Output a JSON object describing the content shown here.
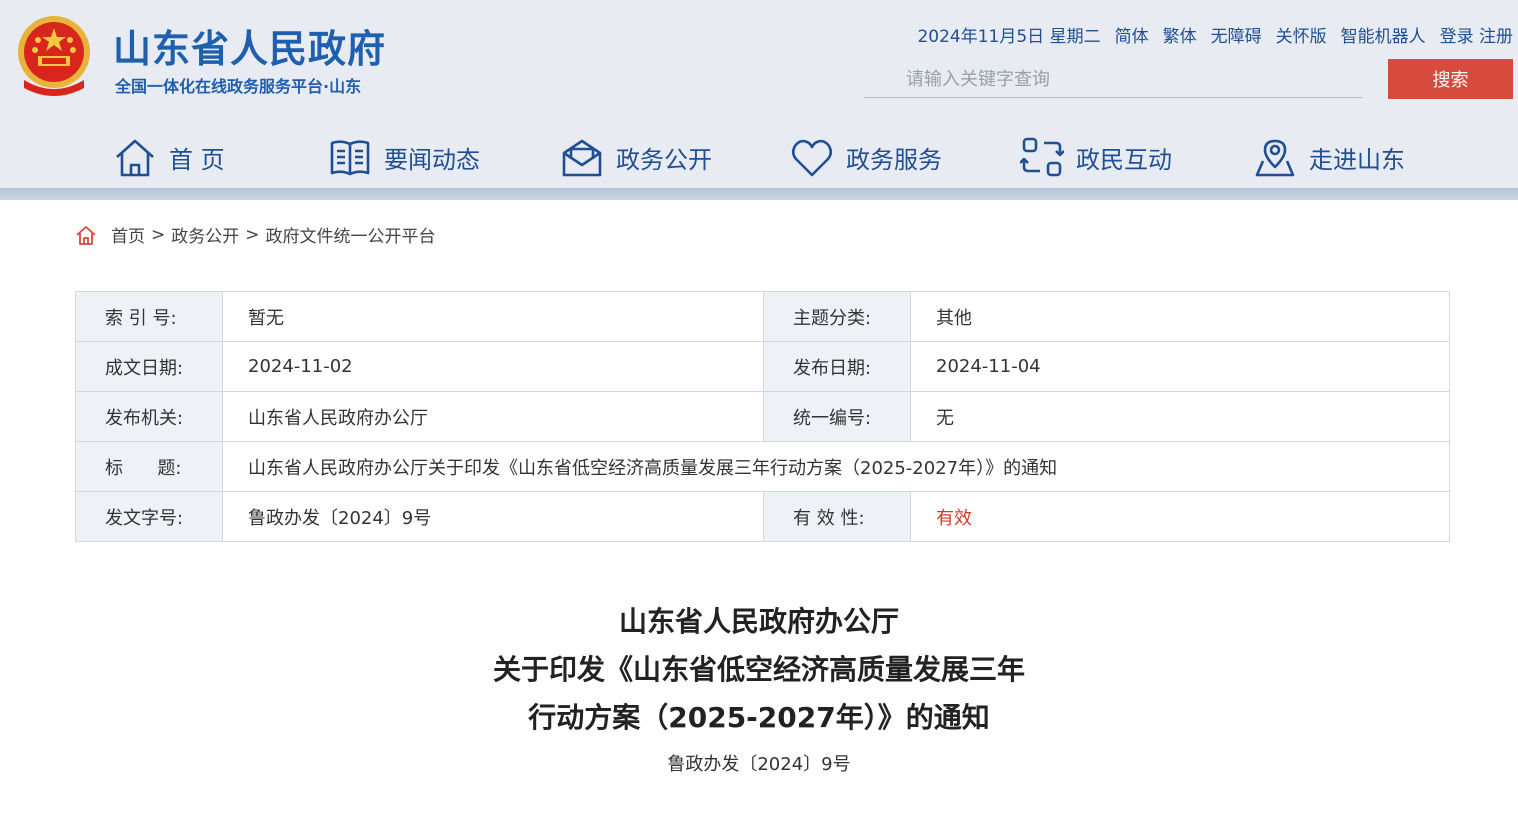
{
  "site": {
    "title": "山东省人民政府",
    "subtitle": "全国一体化在线政务服务平台·山东",
    "emblem_icon": "national-emblem-icon",
    "brand_color": "#1f5fb0"
  },
  "toplinks": {
    "date": "2024年11月5日 星期二",
    "simplified": "简体",
    "traditional": "繁体",
    "accessibility": "无障碍",
    "care_mode": "关怀版",
    "robot": "智能机器人",
    "login_register": "登录 注册"
  },
  "search": {
    "placeholder": "请输入关键字查询",
    "button_label": "搜索",
    "button_color": "#d64b3c"
  },
  "nav": {
    "items": [
      {
        "label": "首 页",
        "icon": "home-icon"
      },
      {
        "label": "要闻动态",
        "icon": "book-icon"
      },
      {
        "label": "政务公开",
        "icon": "mail-open-icon"
      },
      {
        "label": "政务服务",
        "icon": "heart-icon"
      },
      {
        "label": "政民互动",
        "icon": "exchange-icon"
      },
      {
        "label": "走进山东",
        "icon": "location-icon"
      }
    ]
  },
  "breadcrumb": {
    "home": "首页",
    "level1": "政务公开",
    "level2": "政府文件统一公开平台",
    "separator": ">"
  },
  "meta": {
    "index_label": "索 引 号:",
    "index_value": "暂无",
    "topic_label": "主题分类:",
    "topic_value": "其他",
    "created_label": "成文日期:",
    "created_value": "2024-11-02",
    "published_label": "发布日期:",
    "published_value": "2024-11-04",
    "issuer_label": "发布机关:",
    "issuer_value": "山东省人民政府办公厅",
    "code_label": "统一编号:",
    "code_value": "无",
    "title_label": "标      题:",
    "title_value": "山东省人民政府办公厅关于印发《山东省低空经济高质量发展三年行动方案（2025-2027年）》的通知",
    "docno_label": "发文字号:",
    "docno_value": "鲁政办发〔2024〕9号",
    "validity_label": "有 效 性:",
    "validity_value": "有效",
    "validity_color": "#d23b2b"
  },
  "document": {
    "title_line1": "山东省人民政府办公厅",
    "title_line2": "关于印发《山东省低空经济高质量发展三年",
    "title_line3": "行动方案（2025-2027年）》的通知",
    "number": "鲁政办发〔2024〕9号"
  }
}
